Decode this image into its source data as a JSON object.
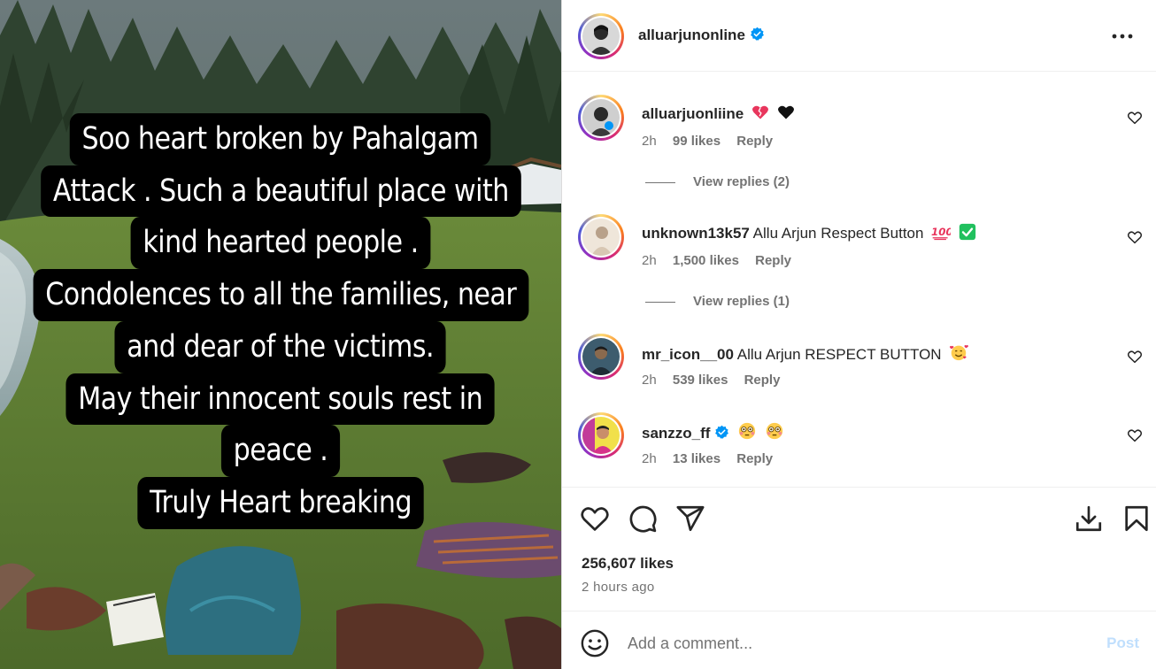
{
  "media": {
    "caption_lines": [
      "Soo heart broken by Pahalgam",
      "Attack . Such a beautiful place with",
      "kind hearted people .",
      "Condolences to all the families, near",
      "and dear of the victims.",
      "May their innocent souls rest in",
      "peace .",
      "Truly Heart breaking"
    ]
  },
  "header": {
    "username": "alluarjunonline",
    "more_icon": "more-horizontal-icon"
  },
  "comments": [
    {
      "username": "alluarjuonliine",
      "text": "",
      "emojis": [
        "broken-heart",
        "black-heart"
      ],
      "time": "2h",
      "likes": "99 likes",
      "reply": "Reply",
      "view_replies": "View replies (2)"
    },
    {
      "username": "unknown13k57",
      "text": "Allu Arjun Respect Button",
      "emojis": [
        "hundred-points",
        "check-mark-button"
      ],
      "time": "2h",
      "likes": "1,500 likes",
      "reply": "Reply",
      "view_replies": "View replies (1)"
    },
    {
      "username": "mr_icon__00",
      "text": "Allu Arjun RESPECT BUTTON",
      "emojis": [
        "smiling-face-with-hearts"
      ],
      "time": "2h",
      "likes": "539 likes",
      "reply": "Reply"
    },
    {
      "username": "sanzzo_ff",
      "text": "",
      "emojis": [
        "flushed-face",
        "flushed-face"
      ],
      "time": "2h",
      "likes": "13 likes",
      "reply": "Reply"
    }
  ],
  "actions": {
    "likes": "256,607 likes",
    "time_ago": "2 hours ago",
    "icons": [
      "heart-icon",
      "comment-icon",
      "share-icon",
      "download-icon",
      "bookmark-icon"
    ]
  },
  "add_comment": {
    "placeholder": "Add a comment...",
    "post_label": "Post"
  },
  "colors": {
    "verified": "#0095f6",
    "post_disabled": "#c0dffd",
    "muted_text": "#737373",
    "primary_text": "#262626"
  }
}
